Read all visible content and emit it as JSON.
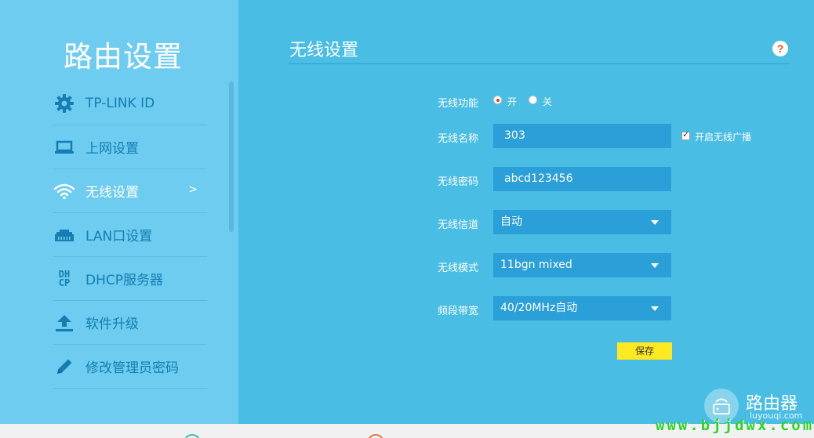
{
  "sidebar": {
    "title": "路由设置",
    "items": [
      {
        "label": "TP-LINK ID",
        "icon": "gear-icon"
      },
      {
        "label": "上网设置",
        "icon": "laptop-icon"
      },
      {
        "label": "无线设置",
        "icon": "wifi-icon",
        "active": true,
        "arrow": ">"
      },
      {
        "label": "LAN口设置",
        "icon": "lan-port-icon"
      },
      {
        "label": "DHCP服务器",
        "icon": "dhcp-icon",
        "icon_text": [
          "DH",
          "CP"
        ]
      },
      {
        "label": "软件升级",
        "icon": "upload-icon"
      },
      {
        "label": "修改管理员密码",
        "icon": "pencil-icon"
      }
    ]
  },
  "main": {
    "title": "无线设置",
    "help_icon": "?",
    "form": {
      "wireless_function": {
        "label": "无线功能",
        "on_label": "开",
        "off_label": "关",
        "selected": "on"
      },
      "ssid": {
        "label": "无线名称",
        "value": "303",
        "broadcast_label": "开启无线广播",
        "broadcast_checked": true
      },
      "password": {
        "label": "无线密码",
        "value": "abcd123456"
      },
      "channel": {
        "label": "无线信道",
        "value": "自动"
      },
      "mode": {
        "label": "无线模式",
        "value": "11bgn mixed"
      },
      "bandwidth": {
        "label": "频段带宽",
        "value": "40/20MHz自动"
      },
      "save_label": "保存"
    }
  },
  "watermark": {
    "title": "路由器",
    "subtitle": "luyouqi.com",
    "url": "www.bjjdwx.com"
  },
  "colors": {
    "sidebar_bg": "#6dccef",
    "main_bg": "#49bde4",
    "field_bg": "#2b9fd8",
    "icon_blue": "#157db0",
    "save_yellow": "#ffe920"
  }
}
